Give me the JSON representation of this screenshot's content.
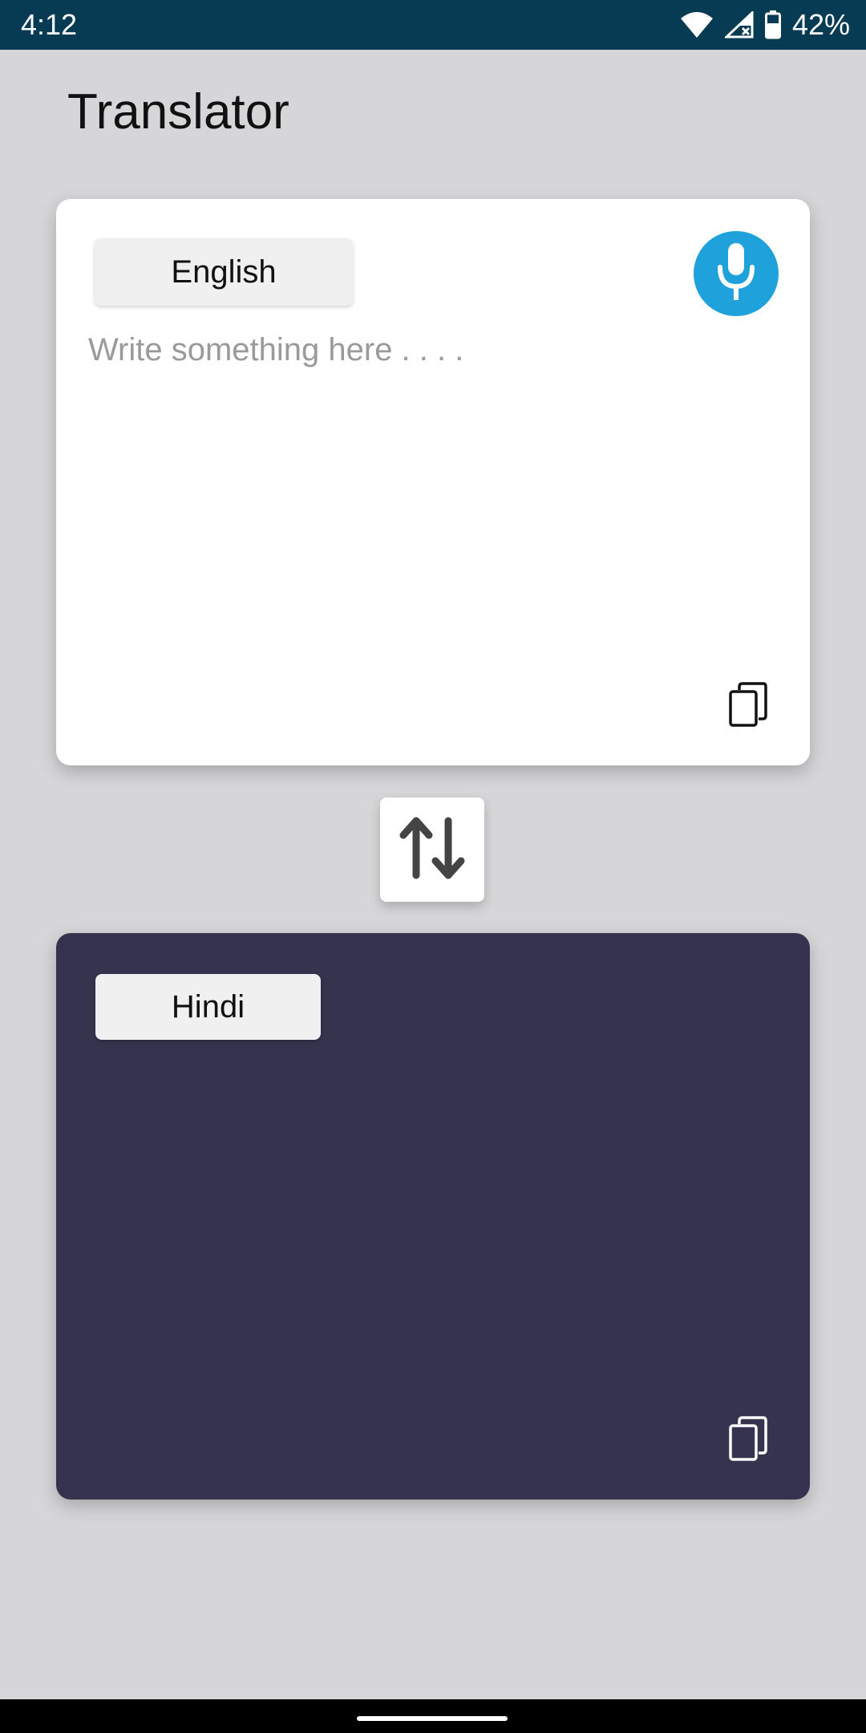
{
  "status_bar": {
    "time": "4:12",
    "battery": "42%",
    "icons": [
      "wifi-icon",
      "signal-icon",
      "battery-icon"
    ]
  },
  "app": {
    "title": "Translator"
  },
  "source": {
    "language": "English",
    "placeholder": "Write something here . . . .",
    "text": "",
    "mic_icon": "microphone-icon",
    "copy_icon": "copy-icon"
  },
  "swap": {
    "icon": "swap-vertical-icon"
  },
  "target": {
    "language": "Hindi",
    "text": "",
    "copy_icon": "copy-icon"
  },
  "colors": {
    "status_bar": "#073a53",
    "background": "#d6d6d8",
    "mic_accent": "#1fa2db",
    "target_card": "#35334d",
    "source_card": "#ffffff",
    "lang_button": "#f0f0f0"
  }
}
